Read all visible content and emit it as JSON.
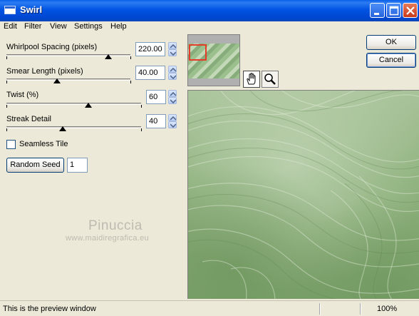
{
  "window": {
    "title": "Swirl"
  },
  "menu": [
    "Edit",
    "Filter",
    "View",
    "Settings",
    "Help"
  ],
  "controls": {
    "whirlpool": {
      "label": "Whirlpool Spacing (pixels)",
      "value": "220.00",
      "position": 0.83
    },
    "smear": {
      "label": "Smear Length (pixels)",
      "value": "40.00",
      "position": 0.41
    },
    "twist": {
      "label": "Twist (%)",
      "value": "60",
      "position": 0.6
    },
    "streak": {
      "label": "Streak Detail",
      "value": "40",
      "position": 0.4
    },
    "seamless": {
      "label": "Seamless Tile",
      "checked": false
    },
    "random_seed": {
      "button": "Random Seed",
      "value": "1"
    }
  },
  "buttons": {
    "ok": "OK",
    "cancel": "Cancel"
  },
  "watermark": {
    "name": "Pinuccia",
    "site": "www.maidiregrafica.eu"
  },
  "status": {
    "text": "This is the preview window",
    "zoom": "100%"
  },
  "colors": {
    "titlebar": "#0054e3",
    "preview_green": "#8cb07b",
    "selection": "#e53b2a"
  },
  "icons": {
    "hand": "hand-pan-icon",
    "zoom": "magnifier-icon"
  }
}
